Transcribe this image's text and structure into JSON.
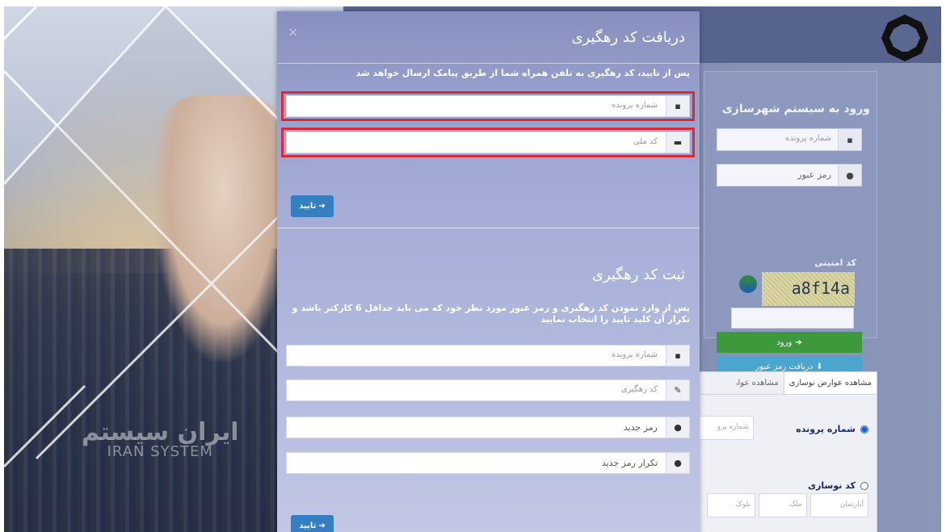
{
  "modal": {
    "close": "×",
    "title": "دریافت کد رهگیری",
    "note": "پس از تایید، کد رهگیری به تلفن همراه شما از طریق پیامک ارسال خواهد شد",
    "file_placeholder": "شماره پرونده",
    "national_placeholder": "کد ملی",
    "confirm": "تایید",
    "register_title": "ثبت کد رهگیری",
    "register_note": "پس از وارد نمودن کد رهگیری و رمز عبور مورد نظر خود که می باید حداقل 6 کارکتر باشد و تکرار آن کلید تایید را انتخاب نمایید",
    "reg_file_placeholder": "شماره پرونده",
    "reg_tracking_placeholder": "کد رهگیری",
    "reg_new_pass_placeholder": "رمز جدید",
    "reg_repeat_pass_placeholder": "تکرار رمز جدید",
    "reg_confirm": "تایید"
  },
  "login": {
    "title": "ورود به سیستم شهرسازی",
    "file_placeholder": "شماره پرونده",
    "password_placeholder": "رمز عبور",
    "captcha_label": "کد امنیتی",
    "captcha_text": "a8f14a",
    "login_button": "ورود",
    "get_password_button": "دریافت رمز عبور"
  },
  "tabs": {
    "tab1": "مشاهده عوارض نوسازی",
    "tab2": "مشاهده عوارض",
    "radio1": "شماره پرونده",
    "radio1_input": "شماره پرو",
    "radio2": "کد نوسازی",
    "apartment": "آپارتمان",
    "property": "ملک",
    "block": "بلوک"
  },
  "brand": {
    "fa": "ایران سیستم",
    "en": "IRAN SYSTEM"
  }
}
